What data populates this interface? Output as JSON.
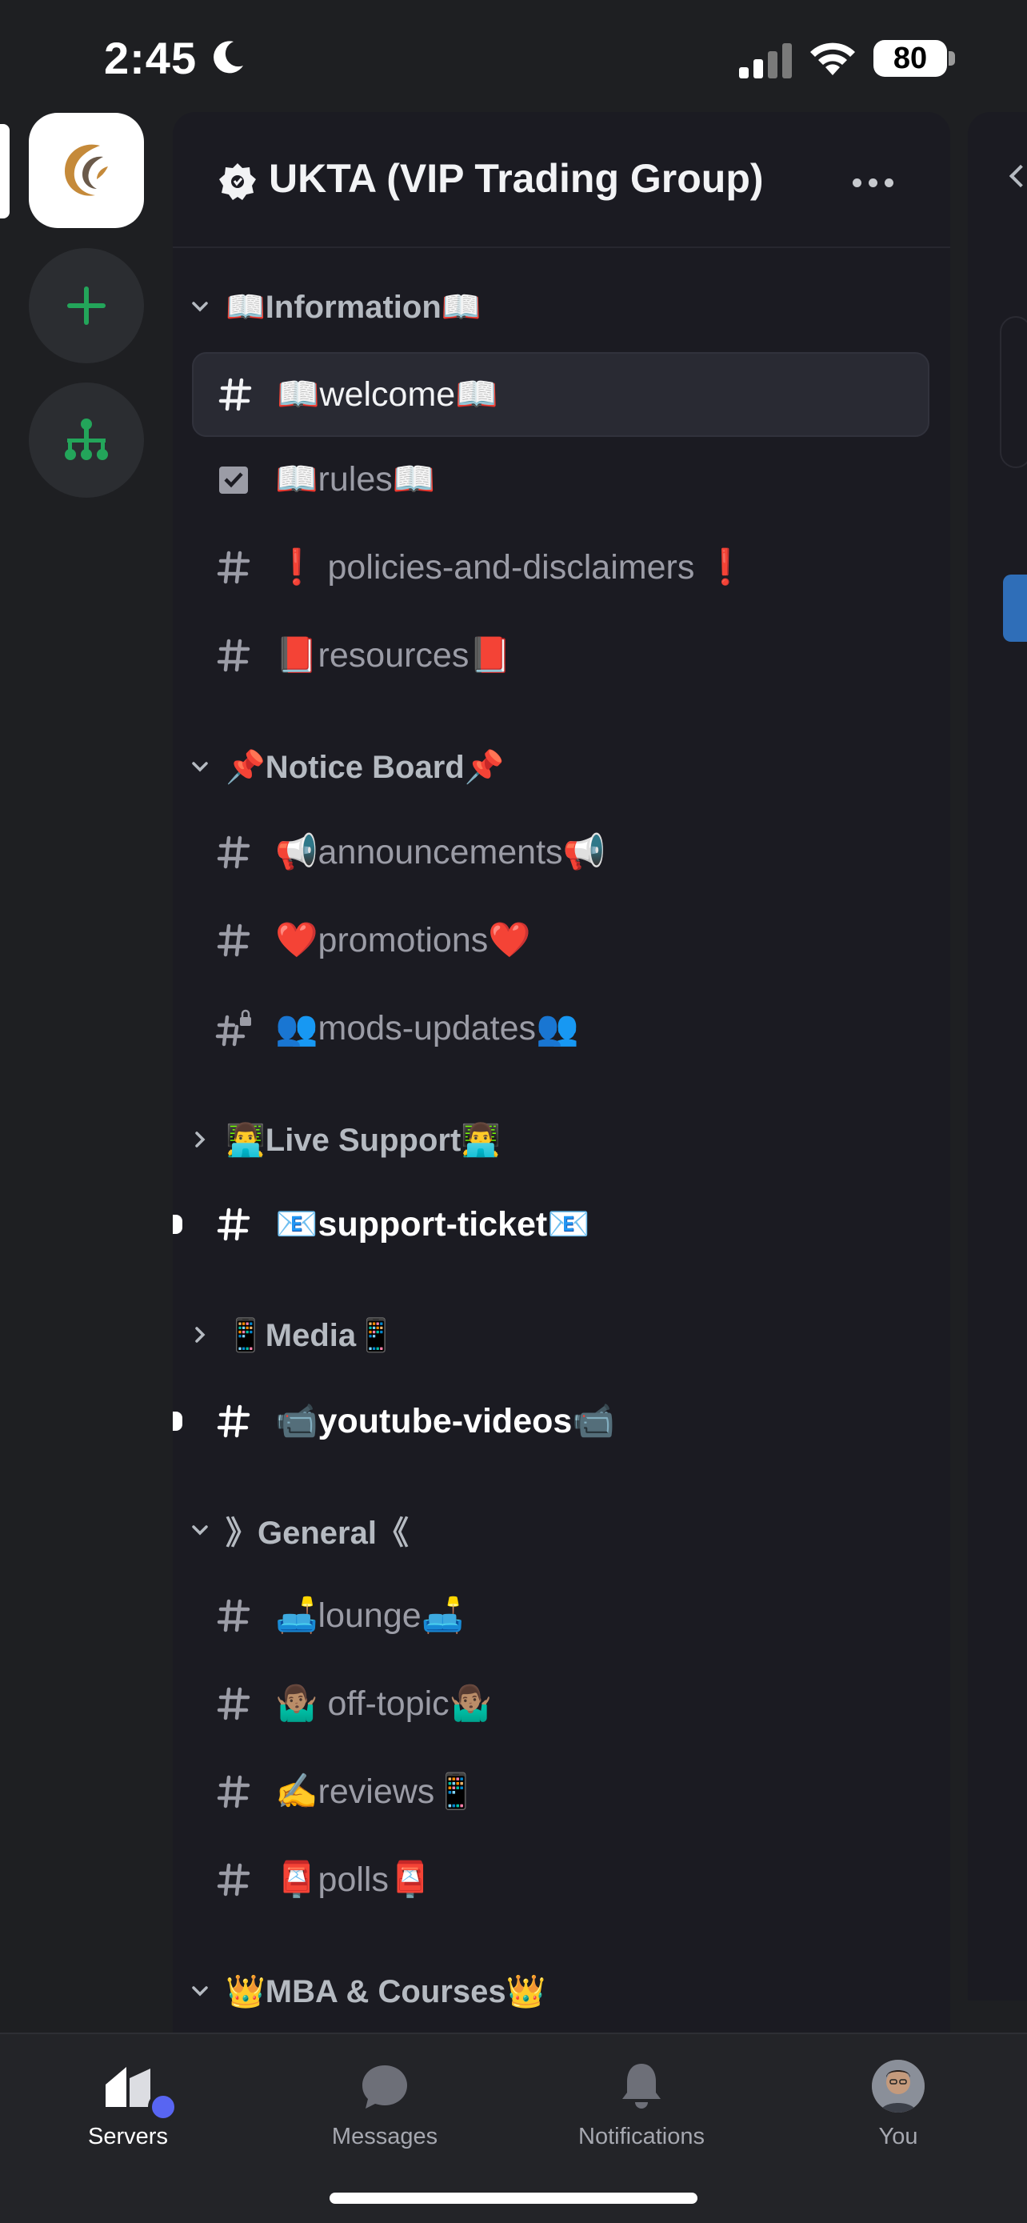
{
  "status_bar": {
    "time": "2:45",
    "battery": "80"
  },
  "colors": {
    "accent": "#5865f2",
    "add_server": "#23a55a",
    "background": "#1e1f22",
    "panel": "#1b1b22"
  },
  "server_rail": {
    "servers": [
      {
        "name": "ukta-logo-icon",
        "active": true
      },
      {
        "name": "add-server-icon"
      },
      {
        "name": "discover-hub-icon"
      }
    ]
  },
  "guild": {
    "name": "UKTA (VIP Trading Group)",
    "icon": "guild-badge-icon",
    "menu_icon": "more-dots-icon"
  },
  "categories": [
    {
      "label": "📖Information📖",
      "collapsed": false
    },
    {
      "label": "📌Notice Board📌",
      "collapsed": false
    },
    {
      "label": "👨‍💻Live Support👨‍💻",
      "collapsed": true
    },
    {
      "label": "📱Media📱",
      "collapsed": true
    },
    {
      "label": "》General《",
      "collapsed": false
    },
    {
      "label": "👑MBA & Courses👑",
      "collapsed": false
    }
  ],
  "channels": [
    {
      "label": "📖welcome📖",
      "icon": "hash-icon",
      "selected": true
    },
    {
      "label": "📖rules📖",
      "icon": "rules-checkbox-icon"
    },
    {
      "label": "❗ policies-and-disclaimers ❗",
      "icon": "hash-icon"
    },
    {
      "label": "📕resources📕",
      "icon": "hash-icon"
    },
    {
      "label": "📢announcements📢",
      "icon": "hash-icon"
    },
    {
      "label": "❤️promotions❤️",
      "icon": "hash-icon"
    },
    {
      "label": "👥mods-updates👥",
      "icon": "locked-hash-icon"
    },
    {
      "label": "📧support-ticket📧",
      "icon": "hash-icon",
      "unread": true
    },
    {
      "label": "📹youtube-videos📹",
      "icon": "hash-icon",
      "unread": true
    },
    {
      "label": "🛋️lounge🛋️",
      "icon": "hash-icon"
    },
    {
      "label": "🤷🏽‍♂️ off-topic🤷🏽‍♂️",
      "icon": "hash-icon"
    },
    {
      "label": "✍️reviews📱",
      "icon": "hash-icon"
    },
    {
      "label": "📮polls📮",
      "icon": "hash-icon"
    }
  ],
  "tabs": [
    {
      "label": "Servers",
      "icon": "servers-icon",
      "active": true
    },
    {
      "label": "Messages",
      "icon": "messages-icon"
    },
    {
      "label": "Notifications",
      "icon": "bell-icon"
    },
    {
      "label": "You",
      "icon": "avatar"
    }
  ]
}
